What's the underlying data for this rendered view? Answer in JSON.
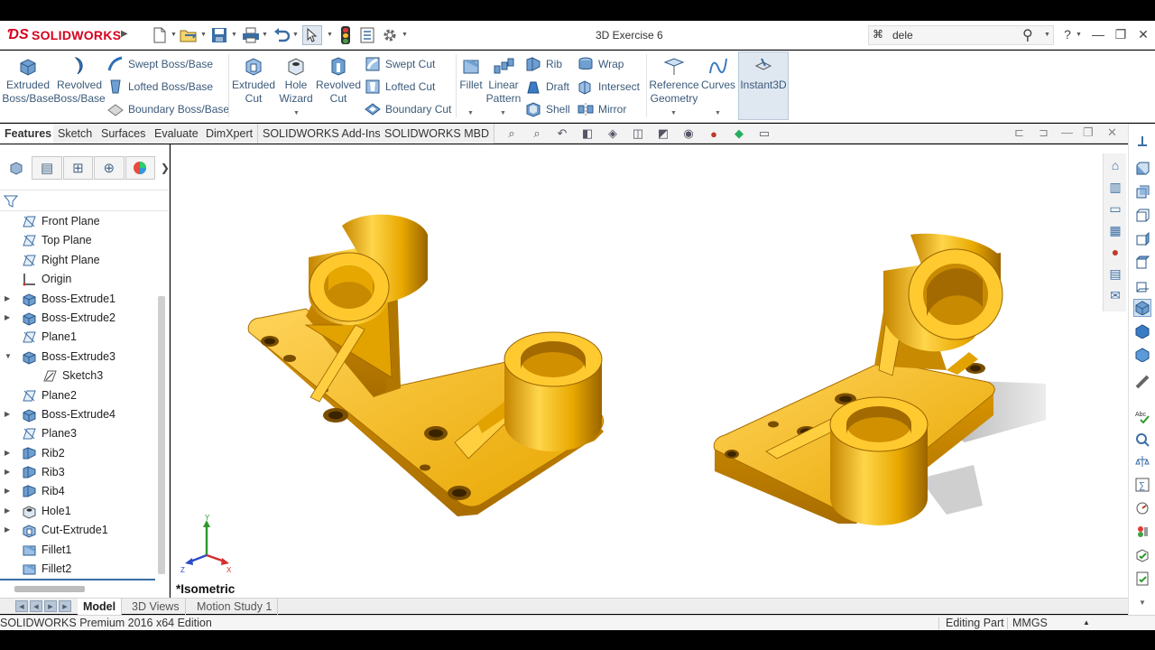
{
  "app": {
    "brand": "SOLIDWORKS",
    "document_title": "3D Exercise 6",
    "search_value": "dele",
    "help_label": "?"
  },
  "ribbon": {
    "extruded_boss": "Extruded Boss/Base",
    "revolved_boss": "Revolved Boss/Base",
    "swept_boss": "Swept Boss/Base",
    "lofted_boss": "Lofted Boss/Base",
    "boundary_boss": "Boundary Boss/Base",
    "extruded_cut": "Extruded Cut",
    "hole_wizard": "Hole Wizard",
    "revolved_cut": "Revolved Cut",
    "swept_cut": "Swept Cut",
    "lofted_cut": "Lofted Cut",
    "boundary_cut": "Boundary Cut",
    "fillet": "Fillet",
    "linear_pattern": "Linear Pattern",
    "rib": "Rib",
    "draft": "Draft",
    "shell": "Shell",
    "wrap": "Wrap",
    "intersect": "Intersect",
    "mirror": "Mirror",
    "reference_geometry": "Reference Geometry",
    "curves": "Curves",
    "instant3d": "Instant3D"
  },
  "tabs": [
    "Features",
    "Sketch",
    "Surfaces",
    "Evaluate",
    "DimXpert",
    "SOLIDWORKS Add-Ins",
    "SOLIDWORKS MBD"
  ],
  "tree": [
    {
      "label": "Front Plane",
      "icon": "plane-icon",
      "expandable": false,
      "child": false
    },
    {
      "label": "Top Plane",
      "icon": "plane-icon",
      "expandable": false,
      "child": false
    },
    {
      "label": "Right Plane",
      "icon": "plane-icon",
      "expandable": false,
      "child": false
    },
    {
      "label": "Origin",
      "icon": "origin-icon",
      "expandable": false,
      "child": false
    },
    {
      "label": "Boss-Extrude1",
      "icon": "extrude-icon",
      "expandable": true,
      "child": false
    },
    {
      "label": "Boss-Extrude2",
      "icon": "extrude-icon",
      "expandable": true,
      "child": false
    },
    {
      "label": "Plane1",
      "icon": "plane-icon",
      "expandable": false,
      "child": false
    },
    {
      "label": "Boss-Extrude3",
      "icon": "extrude-icon",
      "expandable": true,
      "expanded": true,
      "child": false
    },
    {
      "label": "Sketch3",
      "icon": "sketch-icon",
      "expandable": false,
      "child": true
    },
    {
      "label": "Plane2",
      "icon": "plane-icon",
      "expandable": false,
      "child": false
    },
    {
      "label": "Boss-Extrude4",
      "icon": "extrude-icon",
      "expandable": true,
      "child": false
    },
    {
      "label": "Plane3",
      "icon": "plane-icon",
      "expandable": false,
      "child": false
    },
    {
      "label": "Rib2",
      "icon": "rib-icon",
      "expandable": true,
      "child": false
    },
    {
      "label": "Rib3",
      "icon": "rib-icon",
      "expandable": true,
      "child": false
    },
    {
      "label": "Rib4",
      "icon": "rib-icon",
      "expandable": true,
      "child": false
    },
    {
      "label": "Hole1",
      "icon": "hole-icon",
      "expandable": true,
      "child": false
    },
    {
      "label": "Cut-Extrude1",
      "icon": "cut-icon",
      "expandable": true,
      "child": false
    },
    {
      "label": "Fillet1",
      "icon": "fillet-icon",
      "expandable": false,
      "child": false
    },
    {
      "label": "Fillet2",
      "icon": "fillet-icon",
      "expandable": false,
      "child": false
    }
  ],
  "bottom_tabs": [
    "Model",
    "3D Views",
    "Motion Study 1"
  ],
  "viewport": {
    "view_label": "*Isometric",
    "triad": {
      "x": "X",
      "y": "Y",
      "z": "Z"
    }
  },
  "status": {
    "edition": "SOLIDWORKS Premium 2016 x64 Edition",
    "mode": "Editing Part",
    "units": "MMGS"
  },
  "colors": {
    "part_gold": "#e8a800",
    "brand_red": "#d6001c",
    "accent_blue": "#3a6ea5"
  }
}
